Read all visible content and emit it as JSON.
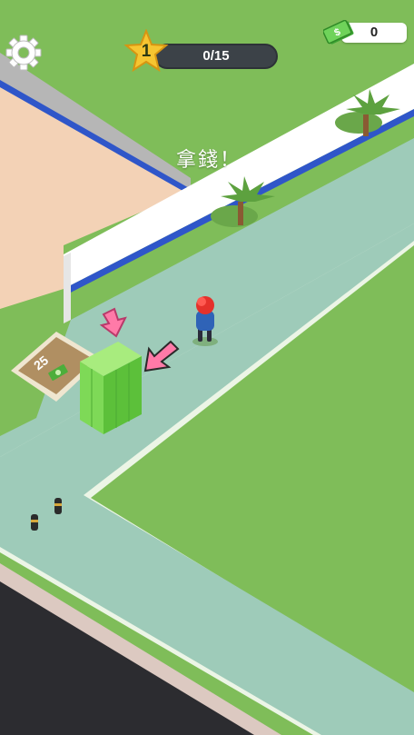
{
  "hud": {
    "level": {
      "number": "1",
      "progress_text": "0/15",
      "progress": 0
    },
    "money": {
      "amount": "0"
    },
    "settings_icon": "gear-icon",
    "cash_icon": "cash-icon"
  },
  "scene": {
    "hint_text": "拿錢！",
    "pad_price": "25",
    "pad_icon": "cash-icon",
    "arrows": [
      "pink-down-arrow",
      "pink-diagonal-arrow"
    ]
  },
  "colors": {
    "grass": "#7fbd59",
    "sidewalk": "#9ecbb9",
    "sand": "#f3d2b6",
    "road": "#2c2c30",
    "wall": "#ffffff",
    "wall_trim": "#2f56c9",
    "money_green": "#7ed957",
    "arrow_pink": "#ff7aa8",
    "player_cap": "#e5312b",
    "player_shirt": "#2f63b7"
  }
}
